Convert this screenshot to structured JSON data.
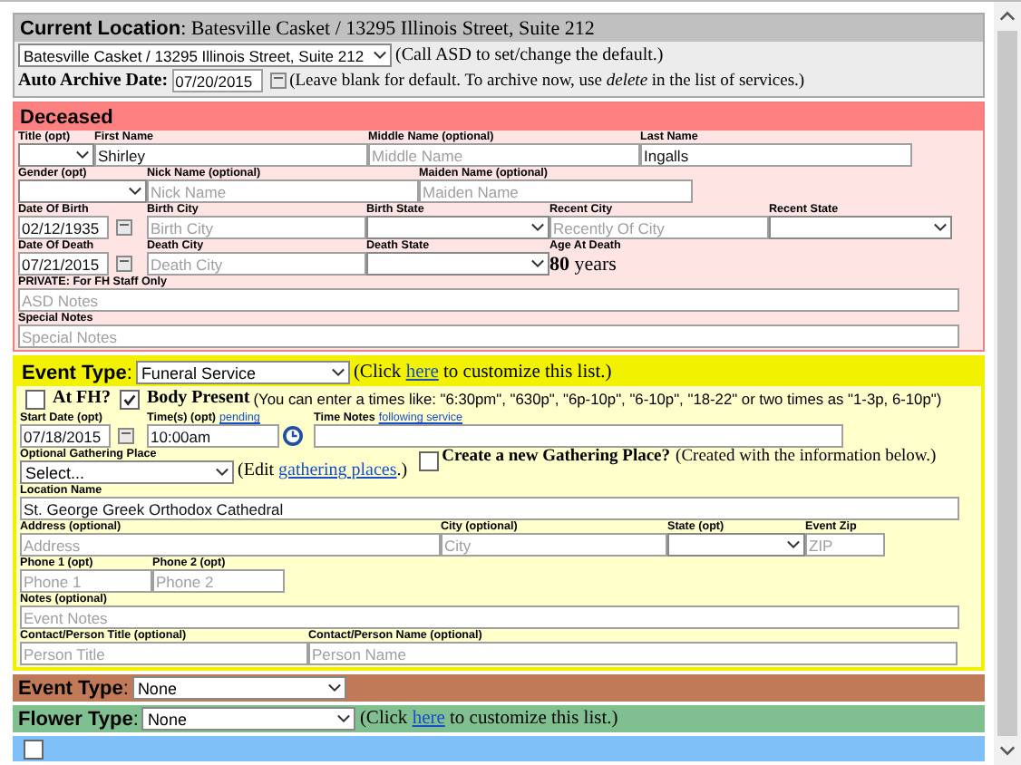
{
  "location": {
    "heading": "**Current Location**: Batesville Casket / 13295 Illinois Street, Suite 212",
    "select": "Batesville Casket / 13295 Illinois Street, Suite 212",
    "select_note": "(Call ASD to set/change the default.)",
    "archive_label": "**Auto Archive Date**:",
    "archive_date": "07/20/2015",
    "archive_note": "(Leave blank for default. To archive now, use *delete* in the list of services.)"
  },
  "deceased": {
    "title": "Deceased",
    "rows": [
      [
        {
          "kind": "select",
          "label": "Title (opt)"
        },
        {
          "kind": "text",
          "label": "First Name",
          "value": "Shirley"
        },
        {
          "kind": "text",
          "label": "Middle Name (optional)",
          "placeholder": "Middle Name"
        },
        {
          "kind": "text",
          "label": "Last Name",
          "value": "Ingalls"
        }
      ],
      [
        {
          "kind": "select",
          "label": "Gender (opt)"
        },
        {
          "kind": "text",
          "label": "Nick Name (optional)",
          "placeholder": "Nick Name"
        },
        {
          "kind": "text",
          "label": "Maiden Name (optional)",
          "placeholder": "Maiden Name"
        }
      ],
      [
        {
          "kind": "date",
          "label": "Date Of Birth",
          "value": "02/12/1935"
        },
        {
          "kind": "text",
          "label": "Birth City",
          "placeholder": "Birth City"
        },
        {
          "kind": "select",
          "label": "Birth State"
        },
        {
          "kind": "text",
          "label": "Recent City",
          "placeholder": "Recently Of City"
        },
        {
          "kind": "select",
          "label": "Recent State"
        }
      ],
      [
        {
          "kind": "date",
          "label": "Date Of Death",
          "value": "07/21/2015"
        },
        {
          "kind": "text",
          "label": "Death City",
          "placeholder": "Death City"
        },
        {
          "kind": "select",
          "label": "Death State"
        },
        {
          "kind": "age",
          "label": "Age At Death",
          "value": "**80** years"
        }
      ],
      [
        {
          "kind": "text",
          "label": "PRIVATE: For FH Staff Only",
          "placeholder": "ASD Notes"
        }
      ],
      [
        {
          "kind": "text",
          "label": "Special Notes",
          "placeholder": "Special Notes"
        }
      ]
    ]
  },
  "event": {
    "label": "**Event Type**:",
    "select": "Funeral Service",
    "note": {
      "before": "(Click ",
      "link": "here",
      "after": " to customize this list.)"
    },
    "at_fh": {
      "label": "At FH?",
      "checked": false
    },
    "body_present": {
      "label": "Body Present",
      "checked": true
    },
    "times_hint": "(You can enter a times like: \"6:30pm\", \"630p\", \"6p-10p\", \"6-10p\", \"18-22\" or two times as \"1-3p, 6-10p\")",
    "time_row": [
      {
        "kind": "date",
        "label": "Start Date (opt)",
        "value": "07/18/2015"
      },
      {
        "kind": "time",
        "label": "Time(s) (opt)",
        "link": "pending",
        "value": "10:00am"
      },
      {
        "kind": "text",
        "label": "Time Notes",
        "link": "following service"
      }
    ],
    "gathering": {
      "label": "Optional Gathering Place",
      "select": "Select...",
      "edit_before": "(Edit ",
      "edit_link": "gathering places",
      "edit_after": ".)",
      "create_label": "Create a new Gathering Place?",
      "create_checked": false,
      "create_note": "(Created with the information below.)"
    },
    "rows": [
      [
        {
          "kind": "text",
          "label": "Location Name",
          "value": "St. George Greek Orthodox Cathedral"
        }
      ],
      [
        {
          "kind": "text",
          "label": "Address (optional)",
          "placeholder": "Address"
        },
        {
          "kind": "text",
          "label": "City (optional)",
          "placeholder": "City"
        },
        {
          "kind": "select",
          "label": "State (opt)"
        },
        {
          "kind": "text",
          "label": "Event Zip",
          "placeholder": "ZIP"
        }
      ],
      [
        {
          "kind": "text",
          "label": "Phone 1 (opt)",
          "placeholder": "Phone 1"
        },
        {
          "kind": "text",
          "label": "Phone 2 (opt)",
          "placeholder": "Phone 2"
        }
      ],
      [
        {
          "kind": "text",
          "label": "Notes (optional)",
          "placeholder": "Event Notes"
        }
      ],
      [
        {
          "kind": "text",
          "label": "Contact/Person Title (optional)",
          "placeholder": "Person Title"
        },
        {
          "kind": "text",
          "label": "Contact/Person Name (optional)",
          "placeholder": "Person Name"
        }
      ]
    ]
  },
  "event2": {
    "label": "**Event Type**:",
    "select": "None"
  },
  "flowers": {
    "label": "**Flower Type**:",
    "select": "None",
    "note": {
      "before": "(Click ",
      "link": "here",
      "after": " to customize this list.)"
    }
  },
  "extra": {
    "checked": false
  }
}
